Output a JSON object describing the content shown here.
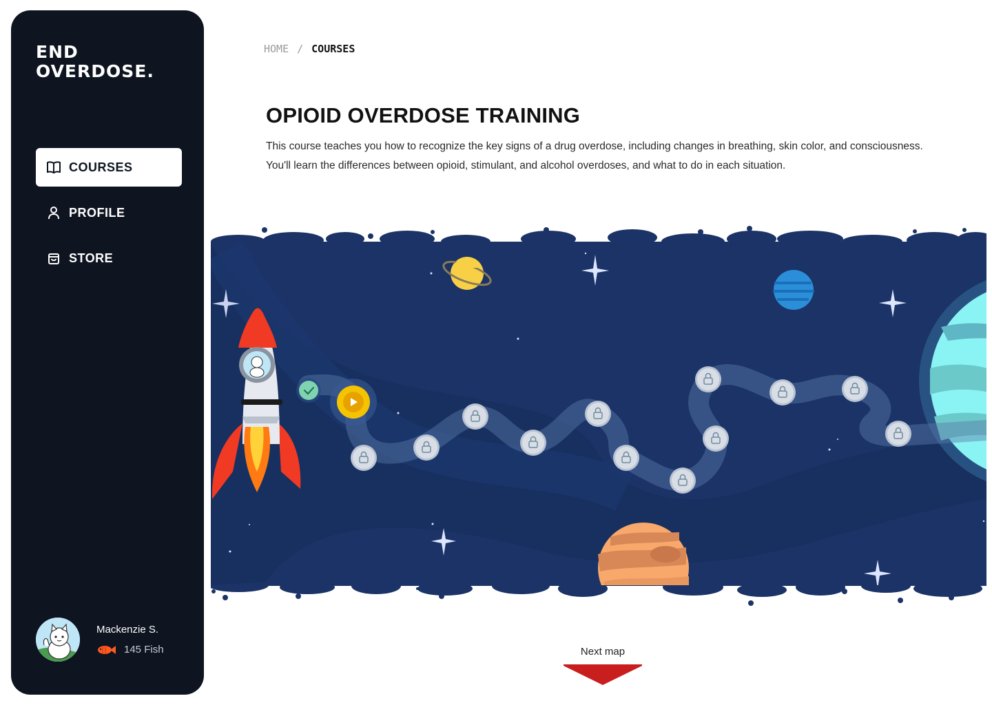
{
  "brand": {
    "line1": "END",
    "line2": "OVERDOSE."
  },
  "nav": {
    "items": [
      {
        "label": "COURSES",
        "icon": "book-icon",
        "active": true
      },
      {
        "label": "PROFILE",
        "icon": "user-icon",
        "active": false
      },
      {
        "label": "STORE",
        "icon": "bag-icon",
        "active": false
      }
    ]
  },
  "user": {
    "name": "Mackenzie S.",
    "fish": "145 Fish"
  },
  "breadcrumb": {
    "home": "HOME",
    "separator": "/",
    "current": "COURSES"
  },
  "course": {
    "title": "OPIOID OVERDOSE TRAINING",
    "description": "This course teaches you how to recognize the key signs of a drug overdose, including changes in breathing, skin color, and consciousness. You'll learn the differences between opioid, stimulant, and alcohol overdoses, and what to do in each situation."
  },
  "map": {
    "lessons": {
      "completed": 1,
      "current": 1,
      "locked": 15
    }
  },
  "next_map": {
    "label": "Next map"
  },
  "colors": {
    "sidebar": "#0e1420",
    "space": "#1b3366",
    "current_node": "#f5c400",
    "completed_node": "#7fd3b0",
    "next_arrow": "#c81e1e"
  }
}
